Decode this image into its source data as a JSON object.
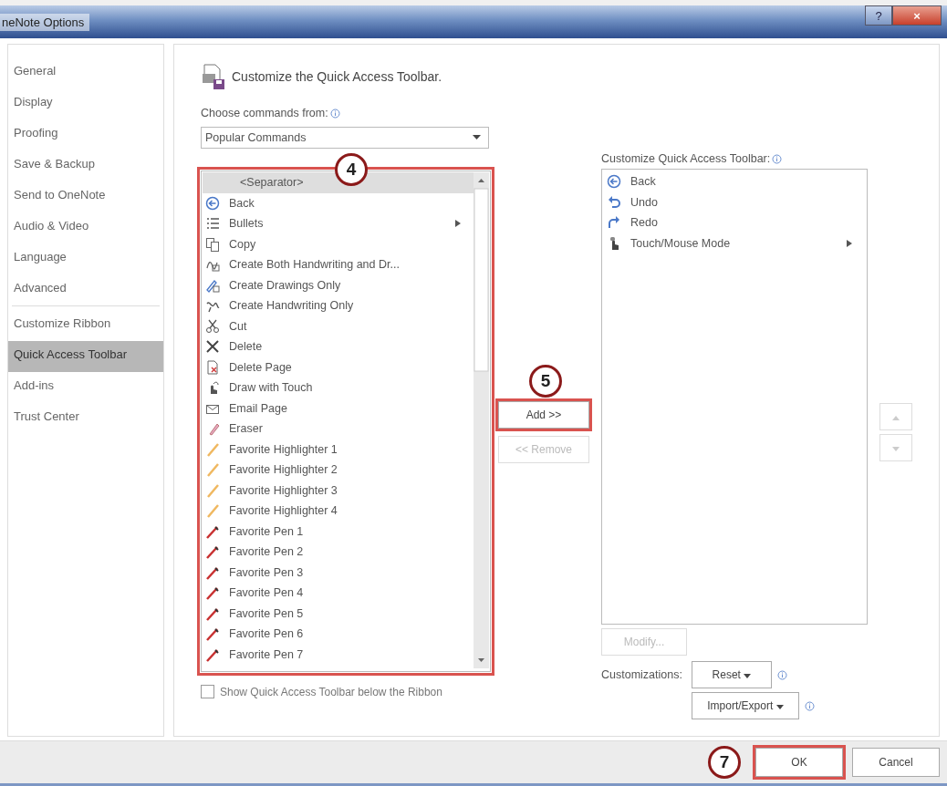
{
  "window": {
    "title": "neNote Options",
    "title_buttons": [
      {
        "kind": "help",
        "label": "?"
      },
      {
        "kind": "close",
        "label": "×"
      }
    ]
  },
  "sidebar": {
    "sections": [
      {
        "items": [
          {
            "label": "General",
            "selected": false
          },
          {
            "label": "Display",
            "selected": false
          },
          {
            "label": "Proofing",
            "selected": false
          },
          {
            "label": "Save & Backup",
            "selected": false
          },
          {
            "label": "Send to OneNote",
            "selected": false
          },
          {
            "label": "Audio & Video",
            "selected": false
          },
          {
            "label": "Language",
            "selected": false
          },
          {
            "label": "Advanced",
            "selected": false
          }
        ]
      },
      {
        "items": [
          {
            "label": "Customize Ribbon",
            "selected": false
          },
          {
            "label": "Quick Access Toolbar",
            "selected": true
          },
          {
            "label": "Add-ins",
            "selected": false
          },
          {
            "label": "Trust Center",
            "selected": false
          }
        ]
      }
    ]
  },
  "content": {
    "heading": "Customize the Quick Access Toolbar.",
    "commands_label": "Choose commands from:",
    "commands_source": {
      "value": "Popular Commands"
    },
    "commands_list": {
      "highlighted": true,
      "callout": "4",
      "items": [
        {
          "label": "<Separator>",
          "selected": true,
          "has_submenu": false
        },
        {
          "label": "Back",
          "selected": false,
          "has_submenu": false
        },
        {
          "label": "Bullets",
          "selected": false,
          "has_submenu": true
        },
        {
          "label": "Copy",
          "selected": false,
          "has_submenu": false
        },
        {
          "label": "Create Both Handwriting and Dr...",
          "selected": false,
          "has_submenu": false
        },
        {
          "label": "Create Drawings Only",
          "selected": false,
          "has_submenu": false
        },
        {
          "label": "Create Handwriting Only",
          "selected": false,
          "has_submenu": false
        },
        {
          "label": "Cut",
          "selected": false,
          "has_submenu": false
        },
        {
          "label": "Delete",
          "selected": false,
          "has_submenu": false
        },
        {
          "label": "Delete Page",
          "selected": false,
          "has_submenu": false
        },
        {
          "label": "Draw with Touch",
          "selected": false,
          "has_submenu": false
        },
        {
          "label": "Email Page",
          "selected": false,
          "has_submenu": false
        },
        {
          "label": "Eraser",
          "selected": false,
          "has_submenu": false
        },
        {
          "label": "Favorite Highlighter 1",
          "selected": false,
          "has_submenu": false
        },
        {
          "label": "Favorite Highlighter 2",
          "selected": false,
          "has_submenu": false
        },
        {
          "label": "Favorite Highlighter 3",
          "selected": false,
          "has_submenu": false
        },
        {
          "label": "Favorite Highlighter 4",
          "selected": false,
          "has_submenu": false
        },
        {
          "label": "Favorite Pen 1",
          "selected": false,
          "has_submenu": false
        },
        {
          "label": "Favorite Pen 2",
          "selected": false,
          "has_submenu": false
        },
        {
          "label": "Favorite Pen 3",
          "selected": false,
          "has_submenu": false
        },
        {
          "label": "Favorite Pen 4",
          "selected": false,
          "has_submenu": false
        },
        {
          "label": "Favorite Pen 5",
          "selected": false,
          "has_submenu": false
        },
        {
          "label": "Favorite Pen 6",
          "selected": false,
          "has_submenu": false
        },
        {
          "label": "Favorite Pen 7",
          "selected": false,
          "has_submenu": false
        }
      ]
    },
    "add_button": {
      "label": "Add >>",
      "disabled": false,
      "highlighted": true,
      "callout": "5"
    },
    "remove_button": {
      "label": "<< Remove",
      "disabled": true,
      "highlighted": false
    },
    "show_below_ribbon": {
      "label": "Show Quick Access Toolbar below the Ribbon",
      "checked": false
    },
    "toolbar_label": "Customize Quick Access Toolbar:",
    "toolbar_list": {
      "items": [
        {
          "label": "Back",
          "selected": false,
          "has_submenu": false
        },
        {
          "label": "Undo",
          "selected": false,
          "has_submenu": false
        },
        {
          "label": "Redo",
          "selected": false,
          "has_submenu": false
        },
        {
          "label": "Touch/Mouse Mode",
          "selected": false,
          "has_submenu": true
        }
      ]
    },
    "move_up_button": {
      "disabled": true
    },
    "move_down_button": {
      "disabled": true
    },
    "modify_button": {
      "label": "Modify...",
      "disabled": true,
      "highlighted": false
    },
    "customizations_label": "Customizations:",
    "reset_button": {
      "label": "Reset",
      "disabled": false,
      "highlighted": false
    },
    "import_export_button": {
      "label": "Import/Export",
      "disabled": false,
      "highlighted": false
    }
  },
  "footer": {
    "ok_button": {
      "label": "OK",
      "disabled": false,
      "highlighted": true,
      "callout": "7"
    },
    "cancel_button": {
      "label": "Cancel",
      "disabled": false,
      "highlighted": false
    }
  }
}
